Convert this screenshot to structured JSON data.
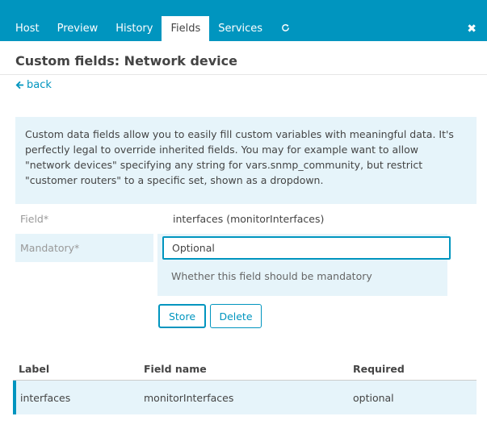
{
  "tabs": [
    {
      "label": "Host"
    },
    {
      "label": "Preview"
    },
    {
      "label": "History"
    },
    {
      "label": "Fields"
    },
    {
      "label": "Services"
    }
  ],
  "active_tab": "Fields",
  "close_symbol": "✖",
  "refresh_icon": "refresh-icon",
  "title": "Custom fields: Network device",
  "back_label": "back",
  "info_text": "Custom data fields allow you to easily fill custom variables with meaningful data. It's perfectly legal to override inherited fields. You may for example want to allow \"network devices\" specifying any string for vars.snmp_community, but restrict \"customer routers\" to a specific set, shown as a dropdown.",
  "form": {
    "field_label": "Field*",
    "field_value": "interfaces (monitorInterfaces)",
    "mandatory_label": "Mandatory*",
    "mandatory_value": "Optional",
    "mandatory_hint": "Whether this field should be mandatory",
    "store_label": "Store",
    "delete_label": "Delete"
  },
  "table": {
    "headers": [
      "Label",
      "Field name",
      "Required"
    ],
    "rows": [
      [
        "interfaces",
        "monitorInterfaces",
        "optional"
      ]
    ]
  },
  "colors": {
    "accent": "#0095bf",
    "highlight_bg": "#e6f4fa"
  }
}
